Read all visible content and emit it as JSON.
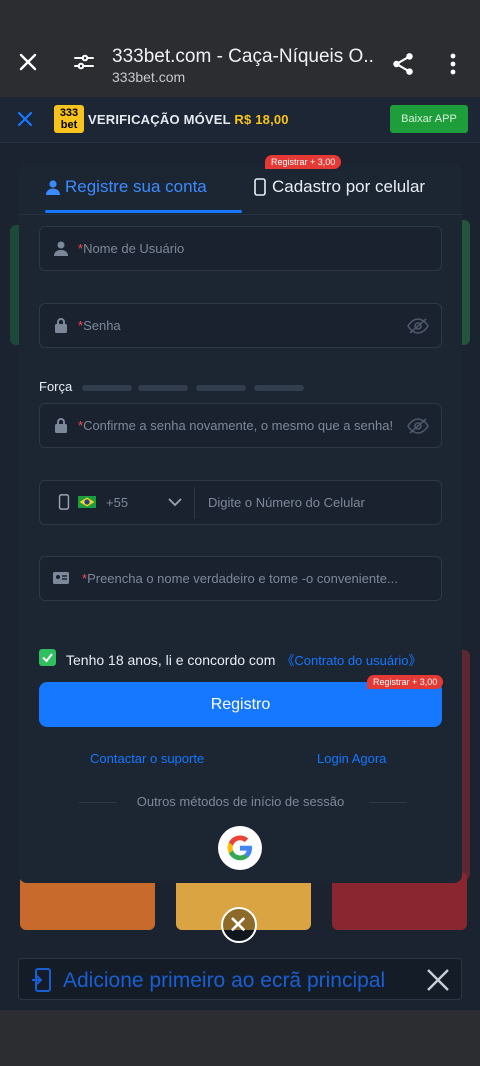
{
  "browser": {
    "title": "333bet.com - Caça-Níqueis O...",
    "url": "333bet.com"
  },
  "banner": {
    "logo_top": "333",
    "logo_bottom": "bet",
    "text": "VERIFICAÇÃO MÓVEL",
    "amount": "R$ 18,00",
    "button": "Baixar APP"
  },
  "tabs": {
    "register": "Registre sua conta",
    "phone": "Cadastro por celular",
    "badge": "Registrar + 3,00"
  },
  "form": {
    "username_placeholder": "Nome de Usuário",
    "password_placeholder": "Senha",
    "strength_label": "Força",
    "confirm_placeholder": "Confirme a senha novamente, o mesmo que a senha!",
    "country_code": "+55",
    "phone_placeholder": "Digite o Número do Celular",
    "realname_placeholder": "Preencha o nome verdadeiro e tome -o conveniente...",
    "agree_text": "Tenho 18 anos, li e concordo com",
    "agree_link": "《Contrato do usuário》",
    "agree_checked": true,
    "submit": "Registro",
    "submit_badge": "Registrar + 3,00",
    "support_link": "Contactar o suporte",
    "login_link": "Login Agora",
    "other_methods": "Outros métodos de início de sessão"
  },
  "add_to_home": {
    "text": "Adicione primeiro ao ecrã principal"
  },
  "colors": {
    "accent": "#1677ff",
    "badge": "#e53935",
    "check": "#2fbf5f",
    "banner_amount": "#f7c31c"
  }
}
